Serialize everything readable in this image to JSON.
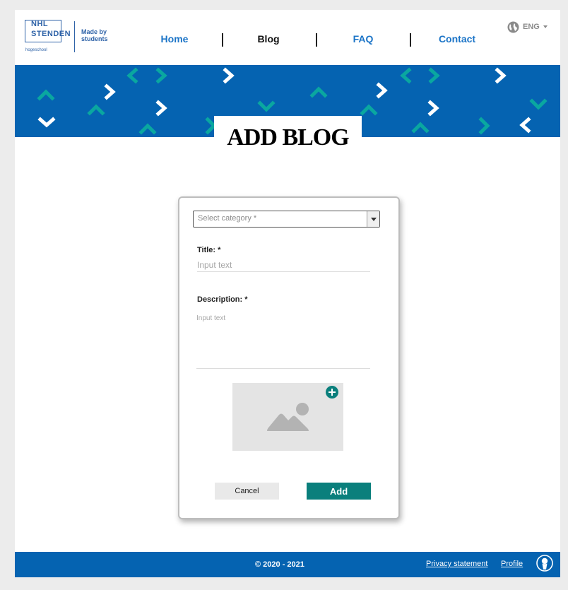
{
  "header": {
    "logo": {
      "line1": "NHL",
      "line2": "STENDEN",
      "sub": "hogeschool",
      "tagline_1": "Made by",
      "tagline_2": "students"
    },
    "nav": [
      {
        "label": "Home"
      },
      {
        "label": "Blog"
      },
      {
        "label": "FAQ"
      },
      {
        "label": "Contact"
      }
    ],
    "active_nav": "Blog",
    "language": {
      "label": "ENG",
      "icon": "globe-icon"
    }
  },
  "banner": {
    "title": "ADD BLOG",
    "background_color": "#0563b1",
    "pattern_colors": [
      "#0aa7a0",
      "#ffffff"
    ]
  },
  "form": {
    "category_placeholder": "Select category *",
    "title_label": "Title: *",
    "title_placeholder": "Input text",
    "description_label": "Description: *",
    "description_placeholder": "Input text",
    "image_icon": "image-placeholder-icon",
    "add_image_icon": "plus-icon",
    "cancel_label": "Cancel",
    "add_label": "Add",
    "accent_color": "#0a7f7c"
  },
  "footer": {
    "copyright": "© 2020 - 2021",
    "links": [
      {
        "label": "Privacy statement"
      },
      {
        "label": "Profile"
      }
    ],
    "profile_icon": "user-avatar-icon"
  }
}
